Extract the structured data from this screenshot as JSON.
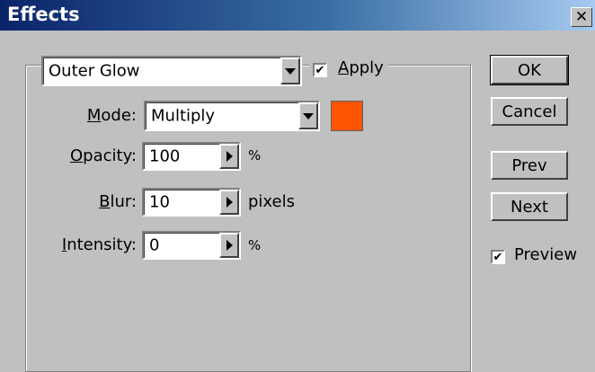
{
  "window": {
    "title": "Effects",
    "close_glyph": "✕"
  },
  "effect": {
    "selected": "Outer Glow",
    "apply_label": "Apply",
    "apply_checked": true
  },
  "mode": {
    "label": "Mode:",
    "value": "Multiply"
  },
  "color": {
    "swatch": "#ff5500"
  },
  "opacity": {
    "label": "Opacity:",
    "value": "100",
    "unit": "%"
  },
  "blur": {
    "label": "Blur:",
    "value": "10",
    "unit": "pixels"
  },
  "intensity": {
    "label": "Intensity:",
    "value": "0",
    "unit": "%"
  },
  "buttons": {
    "ok": "OK",
    "cancel": "Cancel",
    "prev": "Prev",
    "next": "Next"
  },
  "preview": {
    "label": "Preview",
    "checked": true
  },
  "checkmark": "✔"
}
